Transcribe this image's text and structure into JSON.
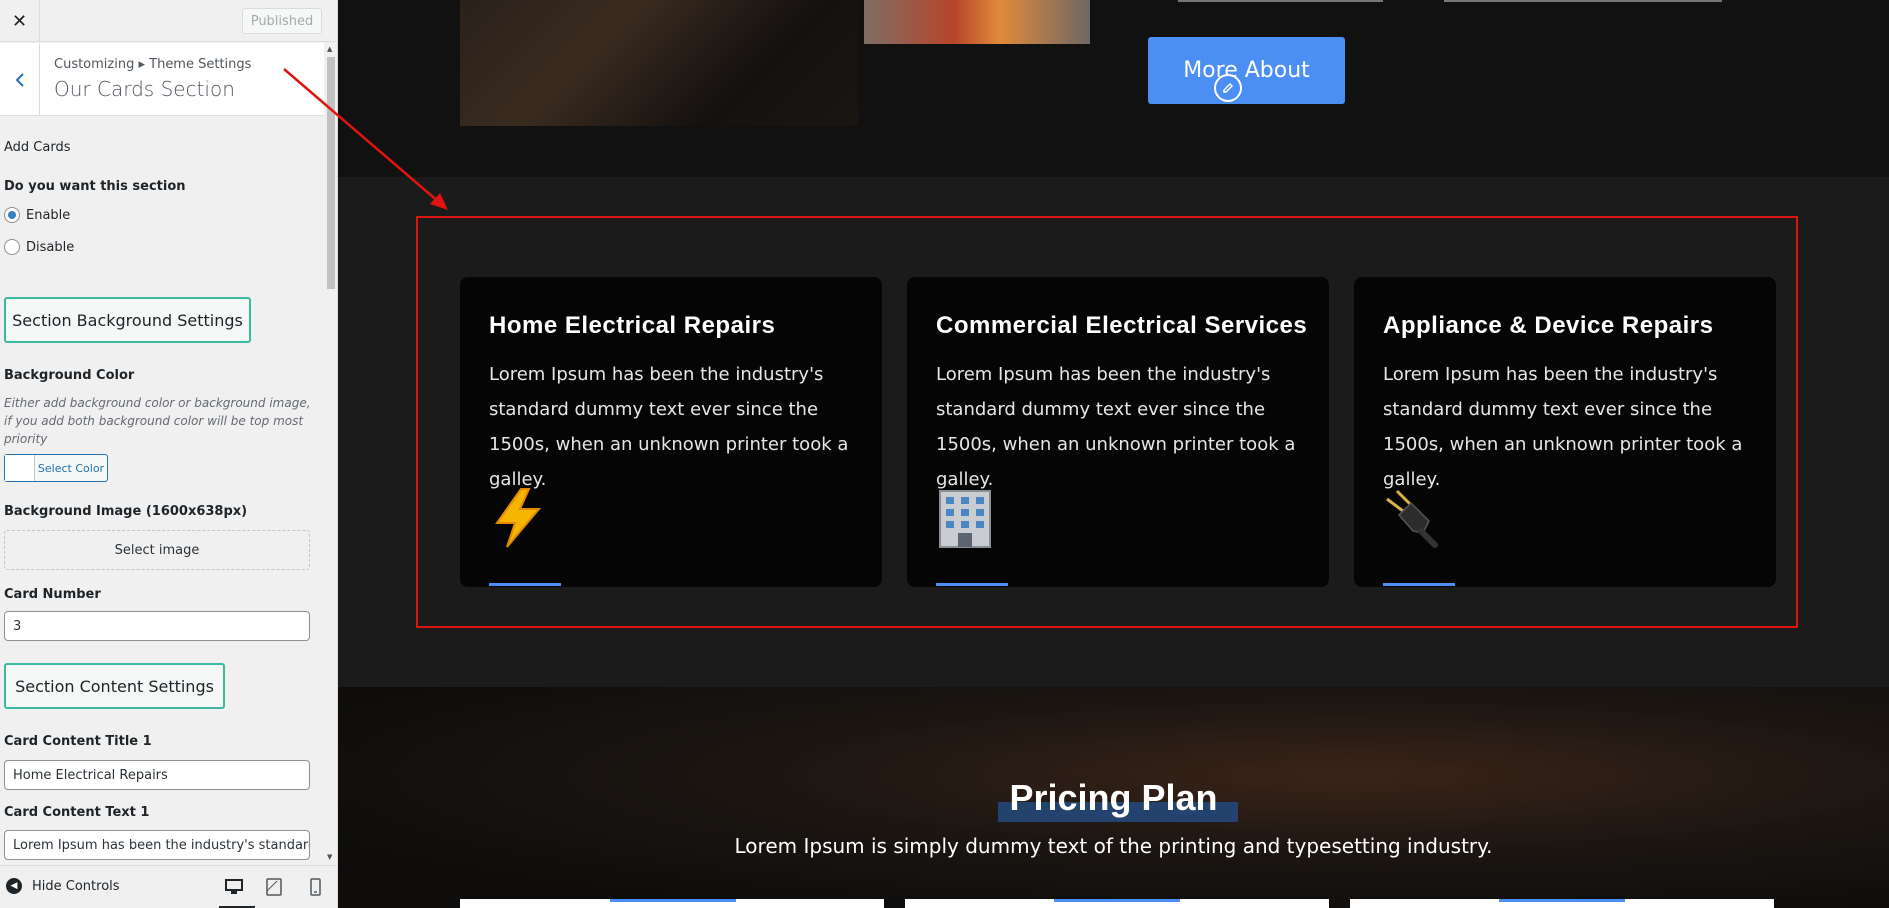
{
  "sidebar": {
    "close_icon": "close-icon",
    "published_label": "Published",
    "breadcrumb": "Customizing ▸ Theme Settings",
    "section_title": "Our Cards Section",
    "add_cards_label": "Add Cards",
    "enable_question": "Do you want this section",
    "radio_enable": "Enable",
    "radio_disable": "Disable",
    "radio_selected": "Enable",
    "bg_settings_button": "Section Background Settings",
    "bg_color_label": "Background Color",
    "bg_color_desc": "Either add background color or background image, if you add both background color will be top most priority",
    "select_color_label": "Select Color",
    "bg_image_label": "Background Image (1600x638px)",
    "select_image_label": "Select image",
    "card_number_label": "Card Number",
    "card_number_value": "3",
    "content_settings_button": "Section Content Settings",
    "card_title_1_label": "Card Content Title 1",
    "card_title_1_value": "Home Electrical Repairs",
    "card_text_1_label": "Card Content Text 1",
    "card_text_1_value": "Lorem Ipsum has been the industry's standard",
    "hide_controls_label": "Hide Controls"
  },
  "preview": {
    "more_about_label": "More About",
    "cards": [
      {
        "title": "Home Electrical Repairs",
        "text": "Lorem Ipsum has been the industry's standard dummy text ever since the 1500s, when an unknown printer took a galley.",
        "icon": "lightning-icon"
      },
      {
        "title": "Commercial Electrical Services",
        "text": "Lorem Ipsum has been the industry's standard dummy text ever since the 1500s, when an unknown printer took a galley.",
        "icon": "office-building-icon"
      },
      {
        "title": "Appliance & Device Repairs",
        "text": "Lorem Ipsum has been the industry's standard dummy text ever since the 1500s, when an unknown printer took a galley.",
        "icon": "electric-plug-icon"
      }
    ],
    "pricing_title": "Pricing Plan",
    "pricing_subtitle": "Lorem Ipsum is simply dummy text of the printing and typesetting industry."
  },
  "colors": {
    "accent_blue": "#4b8ef4",
    "highlight_red": "#e0140f",
    "teal_button_border": "#3eb7a2",
    "card_bg": "#050505"
  }
}
